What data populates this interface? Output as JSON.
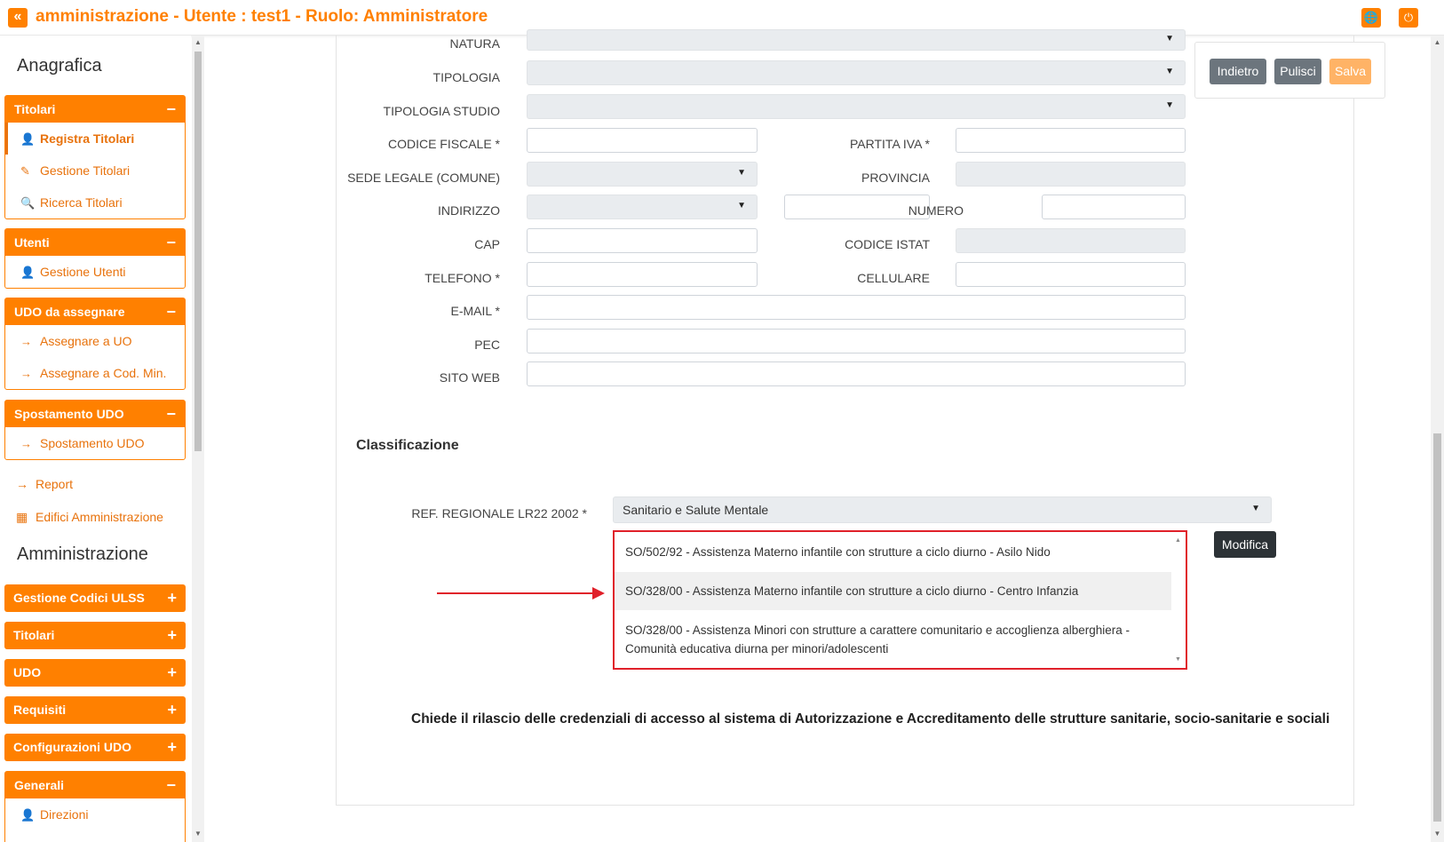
{
  "header": {
    "title": "amministrazione - Utente : test1 - Ruolo: Amministratore",
    "back_icon": "«",
    "globe_icon": "🌐",
    "power_icon": "⏻"
  },
  "sidebar": {
    "section1": "Anagrafica",
    "titolari": {
      "label": "Titolari",
      "toggle": "−",
      "items": [
        {
          "label": "Registra Titolari",
          "icon": "👤"
        },
        {
          "label": "Gestione Titolari",
          "icon": "✎"
        },
        {
          "label": "Ricerca Titolari",
          "icon": "🔍"
        }
      ]
    },
    "utenti": {
      "label": "Utenti",
      "toggle": "−",
      "items": [
        {
          "label": "Gestione Utenti",
          "icon": "👤"
        }
      ]
    },
    "udo_assegnare": {
      "label": "UDO da assegnare",
      "toggle": "−",
      "items": [
        {
          "label": "Assegnare a UO",
          "icon": "→"
        },
        {
          "label": "Assegnare a Cod. Min.",
          "icon": "→"
        }
      ]
    },
    "spostamento": {
      "label": "Spostamento UDO",
      "toggle": "−",
      "items": [
        {
          "label": "Spostamento UDO",
          "icon": "→"
        }
      ]
    },
    "report": {
      "label": "Report",
      "icon": "→"
    },
    "edifici": {
      "label": "Edifici Amministrazione",
      "icon": "▦"
    },
    "section2": "Amministrazione",
    "admin_groups": [
      {
        "label": "Gestione Codici ULSS",
        "toggle": "+"
      },
      {
        "label": "Titolari",
        "toggle": "+"
      },
      {
        "label": "UDO",
        "toggle": "+"
      },
      {
        "label": "Requisiti",
        "toggle": "+"
      },
      {
        "label": "Configurazioni UDO",
        "toggle": "+"
      }
    ],
    "generali": {
      "label": "Generali",
      "toggle": "−",
      "items": [
        {
          "label": "Direzioni",
          "icon": "👤"
        }
      ]
    }
  },
  "form": {
    "natura": "NATURA",
    "tipologia": "TIPOLOGIA",
    "tipologia_studio": "TIPOLOGIA STUDIO",
    "codice_fiscale": "CODICE FISCALE *",
    "partita_iva": "PARTITA IVA *",
    "sede_legale": "SEDE LEGALE (COMUNE)",
    "provincia": "PROVINCIA",
    "indirizzo": "INDIRIZZO",
    "numero": "NUMERO",
    "cap": "CAP",
    "codice_istat": "CODICE ISTAT",
    "telefono": "TELEFONO *",
    "cellulare": "CELLULARE",
    "email": "E-MAIL *",
    "pec": "PEC",
    "sito_web": "SITO WEB",
    "caret": "▼"
  },
  "buttons": {
    "indietro": "Indietro",
    "pulisci": "Pulisci",
    "salva": "Salva",
    "modifica": "Modifica"
  },
  "colors": {
    "accent": "#ff8000",
    "button_dark": "#6c757d",
    "salva": "#ffb366",
    "highlight_border": "#e0202a"
  },
  "classificazione": {
    "heading": "Classificazione",
    "ref_label": "REF. REGIONALE LR22 2002 *",
    "ref_value": "Sanitario e Salute Mentale",
    "options": [
      "SO/502/92 - Assistenza Materno infantile con strutture a ciclo diurno - Asilo Nido",
      "SO/328/00 - Assistenza Materno infantile con strutture a ciclo diurno - Centro Infanzia",
      "SO/328/00 - Assistenza Minori con strutture a carattere comunitario e accoglienza alberghiera - Comunità educativa diurna per minori/adolescenti"
    ]
  },
  "footer_text": "Chiede il rilascio delle credenziali di accesso al sistema di Autorizzazione e Accreditamento delle strutture sanitarie, socio-sanitarie e sociali"
}
